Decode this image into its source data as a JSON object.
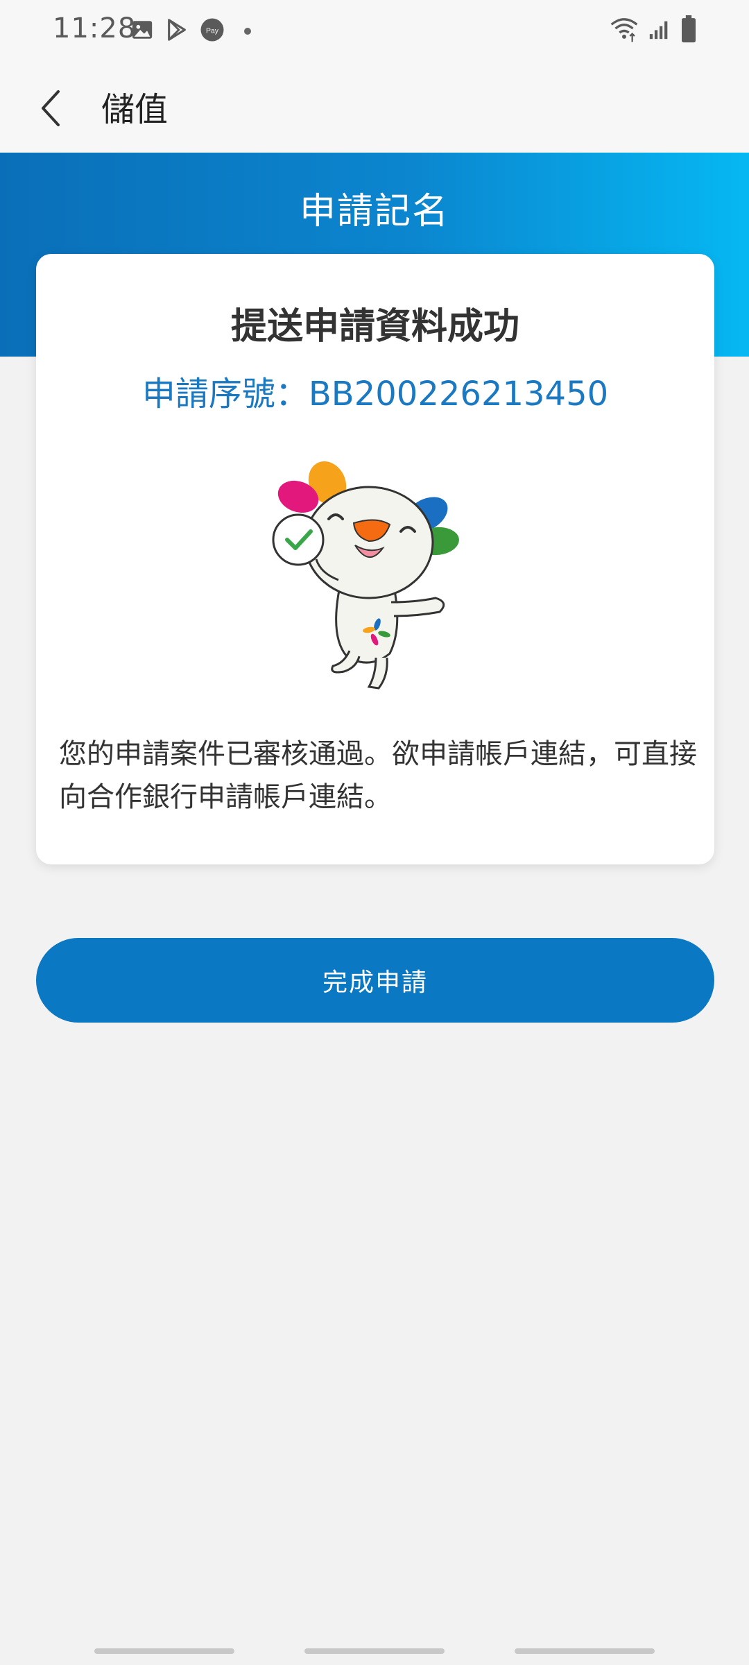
{
  "status_bar": {
    "time": "11:28",
    "left_icons": [
      "gallery-icon",
      "play-store-icon",
      "pay-icon"
    ],
    "pay_label": "Pay",
    "right_icons": [
      "wifi-icon",
      "signal-icon",
      "battery-icon"
    ]
  },
  "app_bar": {
    "back_icon": "chevron-left-icon",
    "title": "儲值"
  },
  "banner": {
    "title": "申請記名"
  },
  "card": {
    "title": "提送申請資料成功",
    "serial_label": "申請序號：",
    "serial_value": "BB200226213450",
    "message": "您的申請案件已審核通過。欲申請帳戶連結，可直接向合作銀行申請帳戶連結。"
  },
  "actions": {
    "complete_label": "完成申請"
  },
  "colors": {
    "primary": "#0a78c2",
    "banner_start": "#0a6fb8",
    "banner_end": "#06b8f2",
    "serial_text": "#1b79c2",
    "background": "#f2f2f2"
  }
}
